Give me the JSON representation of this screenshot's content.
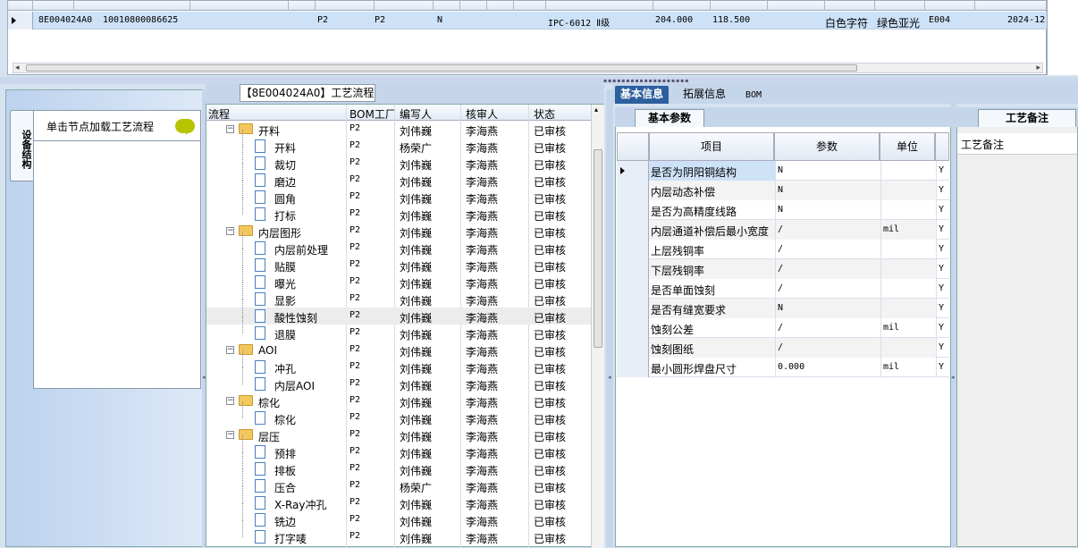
{
  "top_grid": {
    "row": {
      "col1": "8E004024A0",
      "col2": "10010800086625",
      "col3": "P2",
      "col4": "P2",
      "col5": "N",
      "col6": "IPC-6012 Ⅱ级",
      "col7": "204.000",
      "col8": "118.500",
      "col9": "白色字符",
      "col10": "绿色亚光",
      "col11": "E004",
      "col12": "2024-12"
    }
  },
  "left_panel": {
    "vertical_tab": "设备结构",
    "load_hint": "单击节点加载工艺流程"
  },
  "flow_panel": {
    "title": "【8E004024A0】工艺流程",
    "headers": [
      "流程",
      "BOM工厂",
      "编写人",
      "核审人",
      "状态"
    ],
    "rows": [
      {
        "level": 0,
        "type": "folder",
        "name": "开料",
        "factory": "P2",
        "writer": "刘伟巍",
        "reviewer": "李海燕",
        "status": "已审核"
      },
      {
        "level": 1,
        "type": "doc",
        "name": "开料",
        "factory": "P2",
        "writer": "杨荣广",
        "reviewer": "李海燕",
        "status": "已审核"
      },
      {
        "level": 1,
        "type": "doc",
        "name": "裁切",
        "factory": "P2",
        "writer": "刘伟巍",
        "reviewer": "李海燕",
        "status": "已审核"
      },
      {
        "level": 1,
        "type": "doc",
        "name": "磨边",
        "factory": "P2",
        "writer": "刘伟巍",
        "reviewer": "李海燕",
        "status": "已审核"
      },
      {
        "level": 1,
        "type": "doc",
        "name": "圆角",
        "factory": "P2",
        "writer": "刘伟巍",
        "reviewer": "李海燕",
        "status": "已审核"
      },
      {
        "level": 1,
        "type": "doc",
        "name": "打标",
        "factory": "P2",
        "writer": "刘伟巍",
        "reviewer": "李海燕",
        "status": "已审核"
      },
      {
        "level": 0,
        "type": "folder",
        "name": "内层图形",
        "factory": "P2",
        "writer": "刘伟巍",
        "reviewer": "李海燕",
        "status": "已审核"
      },
      {
        "level": 1,
        "type": "doc",
        "name": "内层前处理",
        "factory": "P2",
        "writer": "刘伟巍",
        "reviewer": "李海燕",
        "status": "已审核"
      },
      {
        "level": 1,
        "type": "doc",
        "name": "贴膜",
        "factory": "P2",
        "writer": "刘伟巍",
        "reviewer": "李海燕",
        "status": "已审核"
      },
      {
        "level": 1,
        "type": "doc",
        "name": "曝光",
        "factory": "P2",
        "writer": "刘伟巍",
        "reviewer": "李海燕",
        "status": "已审核"
      },
      {
        "level": 1,
        "type": "doc",
        "name": "显影",
        "factory": "P2",
        "writer": "刘伟巍",
        "reviewer": "李海燕",
        "status": "已审核"
      },
      {
        "level": 1,
        "type": "doc",
        "name": "酸性蚀刻",
        "factory": "P2",
        "writer": "刘伟巍",
        "reviewer": "李海燕",
        "status": "已审核",
        "selected": true
      },
      {
        "level": 1,
        "type": "doc",
        "name": "退膜",
        "factory": "P2",
        "writer": "刘伟巍",
        "reviewer": "李海燕",
        "status": "已审核"
      },
      {
        "level": 0,
        "type": "folder",
        "name": "AOI",
        "factory": "P2",
        "writer": "刘伟巍",
        "reviewer": "李海燕",
        "status": "已审核"
      },
      {
        "level": 1,
        "type": "doc",
        "name": "冲孔",
        "factory": "P2",
        "writer": "刘伟巍",
        "reviewer": "李海燕",
        "status": "已审核"
      },
      {
        "level": 1,
        "type": "doc",
        "name": "内层AOI",
        "factory": "P2",
        "writer": "刘伟巍",
        "reviewer": "李海燕",
        "status": "已审核"
      },
      {
        "level": 0,
        "type": "folder",
        "name": "棕化",
        "factory": "P2",
        "writer": "刘伟巍",
        "reviewer": "李海燕",
        "status": "已审核"
      },
      {
        "level": 1,
        "type": "doc",
        "name": "棕化",
        "factory": "P2",
        "writer": "刘伟巍",
        "reviewer": "李海燕",
        "status": "已审核"
      },
      {
        "level": 0,
        "type": "folder",
        "name": "层压",
        "factory": "P2",
        "writer": "刘伟巍",
        "reviewer": "李海燕",
        "status": "已审核"
      },
      {
        "level": 1,
        "type": "doc",
        "name": "预排",
        "factory": "P2",
        "writer": "刘伟巍",
        "reviewer": "李海燕",
        "status": "已审核"
      },
      {
        "level": 1,
        "type": "doc",
        "name": "排板",
        "factory": "P2",
        "writer": "刘伟巍",
        "reviewer": "李海燕",
        "status": "已审核"
      },
      {
        "level": 1,
        "type": "doc",
        "name": "压合",
        "factory": "P2",
        "writer": "杨荣广",
        "reviewer": "李海燕",
        "status": "已审核"
      },
      {
        "level": 1,
        "type": "doc",
        "name": "X-Ray冲孔",
        "factory": "P2",
        "writer": "刘伟巍",
        "reviewer": "李海燕",
        "status": "已审核"
      },
      {
        "level": 1,
        "type": "doc",
        "name": "铣边",
        "factory": "P2",
        "writer": "刘伟巍",
        "reviewer": "李海燕",
        "status": "已审核"
      },
      {
        "level": 1,
        "type": "doc",
        "name": "打字唛",
        "factory": "P2",
        "writer": "刘伟巍",
        "reviewer": "李海燕",
        "status": "已审核"
      }
    ]
  },
  "right_tabs": {
    "basic": "基本信息",
    "extended": "拓展信息",
    "bom": "BOM"
  },
  "basic_params": {
    "title": "基本参数",
    "headers": {
      "item": "项目",
      "param": "参数",
      "unit": "单位"
    },
    "rows": [
      {
        "item": "是否为阴阳铜结构",
        "param": "N",
        "unit": "",
        "flag": "Y"
      },
      {
        "item": "内层动态补偿",
        "param": "N",
        "unit": "",
        "flag": "Y"
      },
      {
        "item": "是否为高精度线路",
        "param": "N",
        "unit": "",
        "flag": "Y"
      },
      {
        "item": "内层通道补偿后最小宽度",
        "param": "/",
        "unit": "mil",
        "flag": "Y"
      },
      {
        "item": "上层残铜率",
        "param": "/",
        "unit": "",
        "flag": "Y"
      },
      {
        "item": "下层残铜率",
        "param": "/",
        "unit": "",
        "flag": "Y"
      },
      {
        "item": "是否单面蚀刻",
        "param": "/",
        "unit": "",
        "flag": "Y"
      },
      {
        "item": "是否有缝宽要求",
        "param": "N",
        "unit": "",
        "flag": "Y"
      },
      {
        "item": "蚀刻公差",
        "param": "/",
        "unit": "mil",
        "flag": "Y"
      },
      {
        "item": "蚀刻图纸",
        "param": "/",
        "unit": "",
        "flag": "Y"
      },
      {
        "item": "最小圆形焊盘尺寸",
        "param": "0.000",
        "unit": "mil",
        "flag": "Y"
      }
    ]
  },
  "remark_panel": {
    "title": "工艺备注",
    "field": "工艺备注"
  },
  "colors": {
    "accent": "#2c5f9e",
    "selection": "#cde1f7",
    "folder": "#f2c75e"
  }
}
